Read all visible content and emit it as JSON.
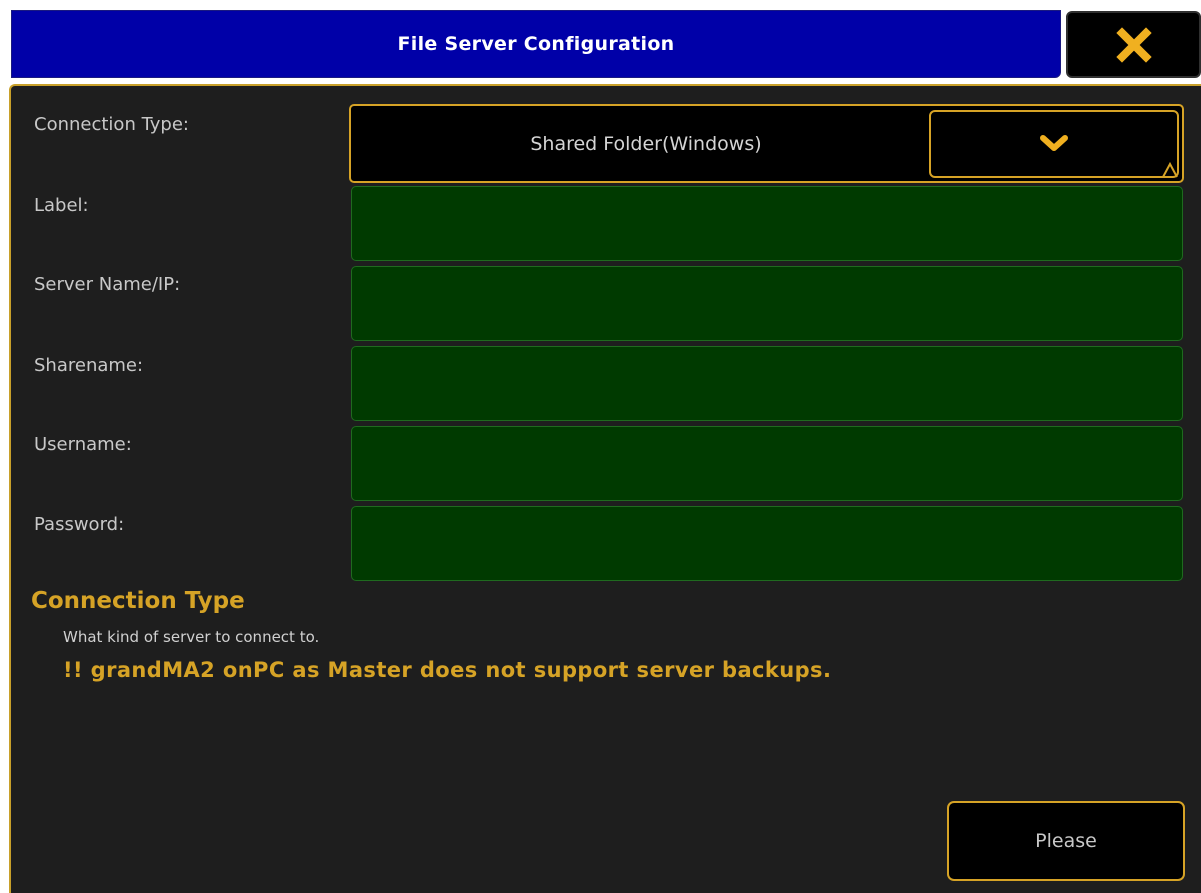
{
  "window": {
    "title": "File Server Configuration",
    "close_icon": "close-icon"
  },
  "form": {
    "connection_type": {
      "label": "Connection Type:",
      "value": "Shared Folder(Windows)",
      "dropdown_icon": "chevron-down-icon"
    },
    "fields": [
      {
        "label": "Label:",
        "value": "",
        "placeholder": ""
      },
      {
        "label": "Server Name/IP:",
        "value": "",
        "placeholder": ""
      },
      {
        "label": "Sharename:",
        "value": "",
        "placeholder": ""
      },
      {
        "label": "Username:",
        "value": "",
        "placeholder": ""
      },
      {
        "label": "Password:",
        "value": "",
        "placeholder": ""
      }
    ]
  },
  "help": {
    "title": "Connection Type",
    "description": "What kind of server to connect to.",
    "warning": "!! grandMA2 onPC as Master does not support server backups."
  },
  "footer": {
    "please_label": "Please"
  },
  "colors": {
    "title_bar": "#0000a8",
    "accent": "#d6a326",
    "panel_bg": "#1e1e1e",
    "field_bg": "#003a00",
    "field_border": "#1f6a1f"
  }
}
